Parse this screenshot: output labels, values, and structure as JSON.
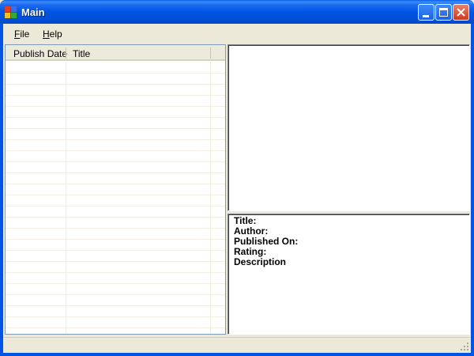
{
  "window": {
    "title": "Main",
    "minimize_icon": "minimize-icon",
    "maximize_icon": "maximize-icon",
    "close_icon": "close-icon"
  },
  "menu": {
    "items": [
      {
        "label": "File",
        "mnemonic": "F",
        "rest": "ile"
      },
      {
        "label": "Help",
        "mnemonic": "H",
        "rest": "elp"
      }
    ]
  },
  "list": {
    "columns": [
      "Publish Date",
      "Title"
    ],
    "rows": []
  },
  "details": {
    "title_label": "Title:",
    "author_label": "Author:",
    "published_label": "Published On:",
    "rating_label": "Rating:",
    "description_label": "Description"
  },
  "colors": {
    "titlebar": "#0054e3",
    "close_button": "#c83c1c",
    "face": "#ece9d8"
  }
}
